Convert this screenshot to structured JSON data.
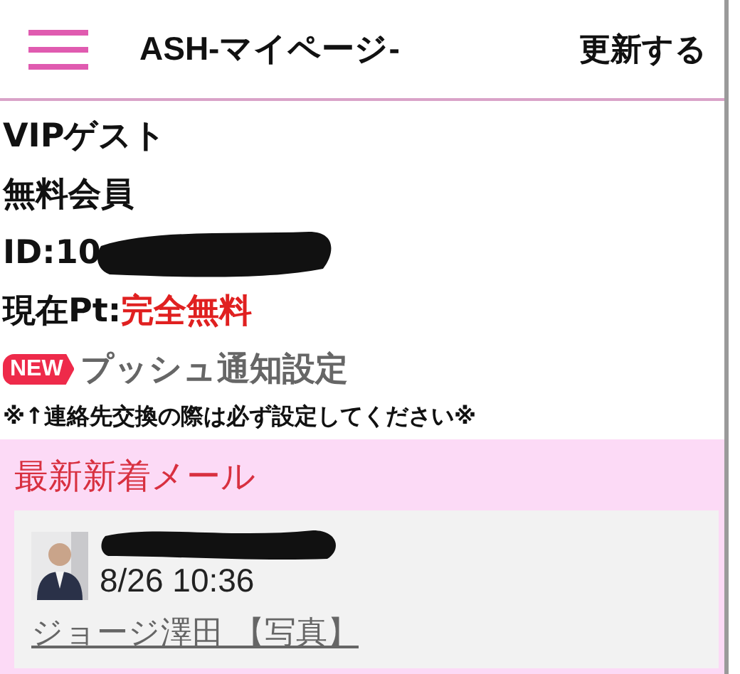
{
  "header": {
    "title": "ASH-マイページ-",
    "action": "更新する"
  },
  "profile": {
    "rank": "VIPゲスト",
    "membership": "無料会員",
    "id_visible": "ID:10",
    "id_redacted": true,
    "points_label": "現在Pt:",
    "points_value": "完全無料",
    "push": {
      "badge": "NEW",
      "label": "プッシュ通知設定"
    },
    "note": "※↑連絡先交換の際は必ず設定してください※"
  },
  "mail_section": {
    "title": "最新新着メール",
    "mails": [
      {
        "sender_redacted": true,
        "time": "8/26 10:36",
        "sender": "ジョージ澤田 【写真】"
      }
    ]
  }
}
